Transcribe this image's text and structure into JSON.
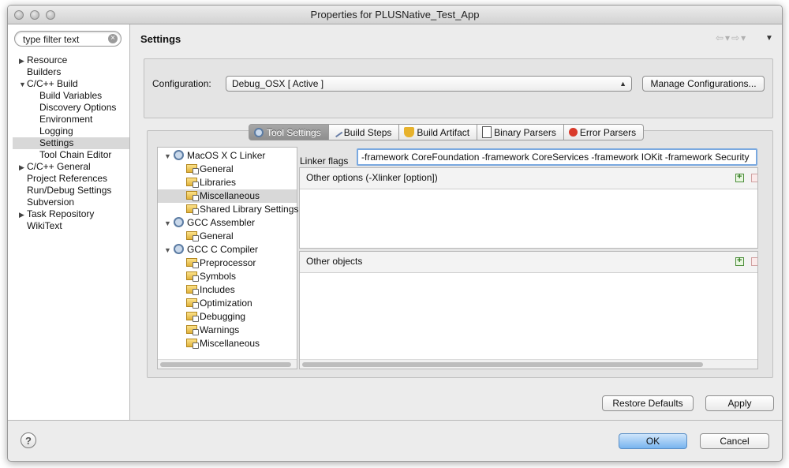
{
  "window": {
    "title": "Properties for PLUSNative_Test_App"
  },
  "sidebar": {
    "filter_placeholder": "type filter text",
    "items": [
      {
        "label": "Resource",
        "expander": "▶"
      },
      {
        "label": "Builders",
        "expander": ""
      },
      {
        "label": "C/C++ Build",
        "expander": "▼"
      },
      {
        "label": "Build Variables",
        "expander": ""
      },
      {
        "label": "Discovery Options",
        "expander": ""
      },
      {
        "label": "Environment",
        "expander": ""
      },
      {
        "label": "Logging",
        "expander": ""
      },
      {
        "label": "Settings",
        "expander": ""
      },
      {
        "label": "Tool Chain Editor",
        "expander": ""
      },
      {
        "label": "C/C++ General",
        "expander": "▶"
      },
      {
        "label": "Project References",
        "expander": ""
      },
      {
        "label": "Run/Debug Settings",
        "expander": ""
      },
      {
        "label": "Subversion",
        "expander": ""
      },
      {
        "label": "Task Repository",
        "expander": "▶"
      },
      {
        "label": "WikiText",
        "expander": ""
      }
    ]
  },
  "content": {
    "title": "Settings",
    "configuration_label": "Configuration:",
    "configuration_value": "Debug_OSX  [ Active ]",
    "manage_button": "Manage Configurations...",
    "tabs": [
      {
        "label": "Tool Settings",
        "icon": "gear-icon"
      },
      {
        "label": "Build Steps",
        "icon": "build-steps-icon"
      },
      {
        "label": "Build Artifact",
        "icon": "trophy-icon"
      },
      {
        "label": "Binary Parsers",
        "icon": "binary-file-icon"
      },
      {
        "label": "Error Parsers",
        "icon": "error-icon"
      }
    ],
    "tool_tree": [
      {
        "label": "MacOS X C Linker",
        "kind": "tool"
      },
      {
        "label": "General",
        "kind": "option"
      },
      {
        "label": "Libraries",
        "kind": "option"
      },
      {
        "label": "Miscellaneous",
        "kind": "option"
      },
      {
        "label": "Shared Library Settings",
        "kind": "option"
      },
      {
        "label": "GCC Assembler",
        "kind": "tool"
      },
      {
        "label": "General",
        "kind": "option"
      },
      {
        "label": "GCC C Compiler",
        "kind": "tool"
      },
      {
        "label": "Preprocessor",
        "kind": "option"
      },
      {
        "label": "Symbols",
        "kind": "option"
      },
      {
        "label": "Includes",
        "kind": "option"
      },
      {
        "label": "Optimization",
        "kind": "option"
      },
      {
        "label": "Debugging",
        "kind": "option"
      },
      {
        "label": "Warnings",
        "kind": "option"
      },
      {
        "label": "Miscellaneous",
        "kind": "option"
      }
    ],
    "linker_flags_label": "Linker flags",
    "linker_flags_value": "-framework CoreFoundation -framework CoreServices -framework IOKit -framework Security",
    "other_options_label": "Other options (-Xlinker [option])",
    "other_objects_label": "Other objects",
    "restore_defaults": "Restore Defaults",
    "apply": "Apply"
  },
  "footer": {
    "help": "?",
    "ok": "OK",
    "cancel": "Cancel"
  },
  "colors": {
    "primary_button": "#78b4ef",
    "selection": "#d8d8d8",
    "focus": "#7aa9e0"
  }
}
